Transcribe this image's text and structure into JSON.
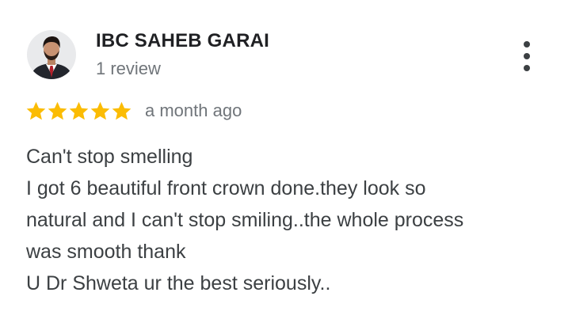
{
  "review": {
    "author_name": "IBC SAHEB GARAI",
    "review_count": "1 review",
    "rating": 5,
    "rating_max": 5,
    "date": "a month ago",
    "text_lines": [
      "Can't stop smelling",
      "I got 6 beautiful front crown done.they look so",
      "natural and I can't stop smiling..the whole process",
      "was smooth thank",
      "U Dr Shweta ur the best seriously.."
    ]
  },
  "icons": {
    "star": "star-icon",
    "more": "more-vert-icon",
    "avatar": "user-avatar"
  },
  "colors": {
    "star": "#fbbc04",
    "author": "#202124",
    "meta": "#70757a",
    "body_text": "#3c4043"
  }
}
